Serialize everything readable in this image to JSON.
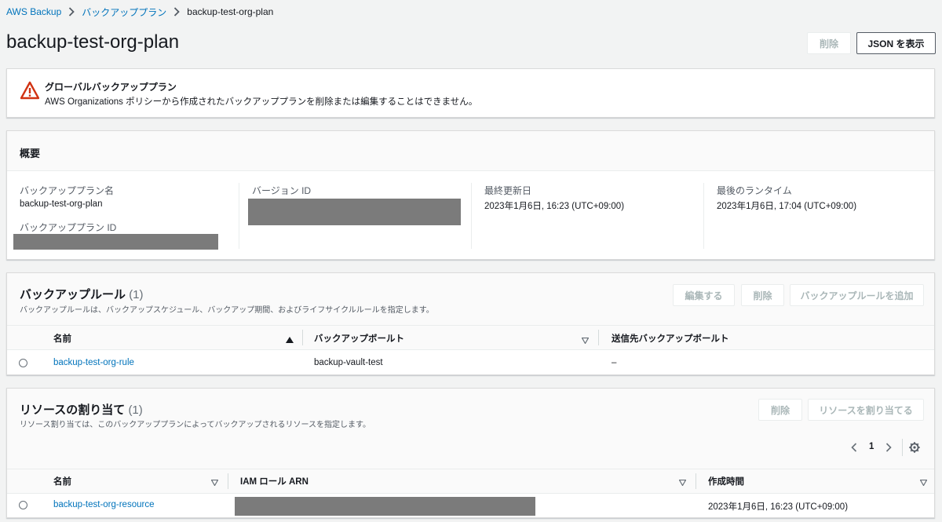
{
  "breadcrumb": {
    "root": "AWS Backup",
    "parent": "バックアッププラン",
    "current": "backup-test-org-plan"
  },
  "header": {
    "title": "backup-test-org-plan",
    "delete_label": "削除",
    "json_label": "JSON を表示"
  },
  "alert": {
    "title": "グローバルバックアッププラン",
    "text": "AWS Organizations ポリシーから作成されたバックアッププランを削除または編集することはできません。",
    "icon": "warning-icon",
    "color": "#d13212"
  },
  "overview": {
    "title": "概要",
    "plan_name_label": "バックアッププラン名",
    "plan_name_value": "backup-test-org-plan",
    "plan_id_label": "バックアッププラン ID",
    "version_id_label": "バージョン ID",
    "last_updated_label": "最終更新日",
    "last_updated_value": "2023年1月6日, 16:23 (UTC+09:00)",
    "last_run_label": "最後のランタイム",
    "last_run_value": "2023年1月6日, 17:04 (UTC+09:00)"
  },
  "rules": {
    "title": "バックアップルール",
    "count": "(1)",
    "description": "バックアップルールは、バックアップスケジュール、バックアップ期間、およびライフサイクルルールを指定します。",
    "edit_label": "編集する",
    "delete_label": "削除",
    "add_label": "バックアップルールを追加",
    "columns": [
      "名前",
      "バックアップボールト",
      "送信先バックアップボールト"
    ],
    "rows": [
      {
        "name": "backup-test-org-rule",
        "vault": "backup-vault-test",
        "dest": "–"
      }
    ]
  },
  "resources": {
    "title": "リソースの割り当て",
    "count": "(1)",
    "description": "リソース割り当ては、このバックアッププランによってバックアップされるリソースを指定します。",
    "delete_label": "削除",
    "assign_label": "リソースを割り当てる",
    "page": "1",
    "columns": [
      "名前",
      "IAM ロール ARN",
      "作成時間"
    ],
    "rows": [
      {
        "name": "backup-test-org-resource",
        "created": "2023年1月6日, 16:23 (UTC+09:00)"
      }
    ]
  },
  "colors": {
    "link": "#0073bb",
    "background": "#f2f3f3",
    "redaction": "#7b7b7b"
  }
}
